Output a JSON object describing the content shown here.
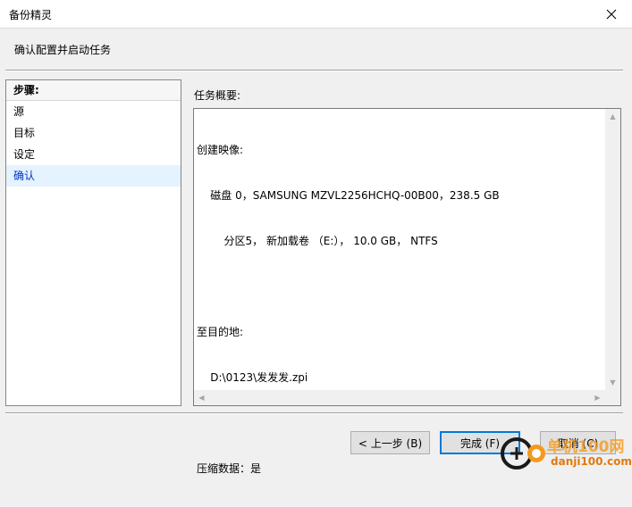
{
  "window": {
    "title": "备份精灵"
  },
  "header": {
    "subtitle": "确认配置并启动任务"
  },
  "steps": {
    "header": "步骤:",
    "items": [
      "源",
      "目标",
      "设定",
      "确认"
    ],
    "active_index": 3
  },
  "summary": {
    "label": "任务概要:",
    "lines": [
      "创建映像:",
      "    磁盘 0，SAMSUNG MZVL2256HCHQ-00B00，238.5 GB",
      "        分区5， 新加载卷 （E:）， 10.0 GB， NTFS",
      "",
      "至目的地:",
      "    D:\\0123\\发发发.zpi",
      "",
      "压缩数据：是"
    ]
  },
  "buttons": {
    "back": "< 上一步 (B)",
    "finish": "完成 (F)",
    "cancel": "取消 (C)"
  },
  "watermark": {
    "site": "danji100.com",
    "brand": "单机100网"
  },
  "colors": {
    "accent": "#0078d7",
    "active_step": "#0033cc",
    "watermark_orange": "#f39a1e"
  }
}
